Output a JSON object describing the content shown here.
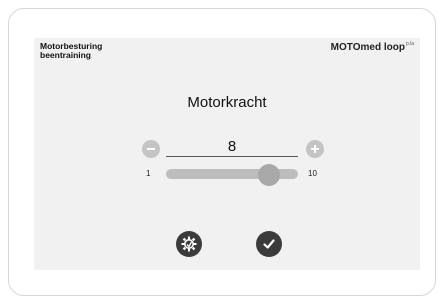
{
  "header": {
    "program_line1": "Motorbesturing",
    "program_line2": "beentraining",
    "brand": "MOTOmed loop",
    "brand_suffix": "p.la"
  },
  "parameter": {
    "title": "Motorkracht",
    "value": "8",
    "min_label": "1",
    "max_label": "10",
    "min": 1,
    "max": 10,
    "current": 8
  },
  "icons": {
    "decrease": "minus-icon",
    "increase": "plus-icon",
    "settings": "settings-gear-icon",
    "confirm": "check-icon"
  },
  "colors": {
    "screen_bg": "#f1f1f1",
    "buttons": "#c4c4c4",
    "action_buttons": "#3b3b3b"
  }
}
